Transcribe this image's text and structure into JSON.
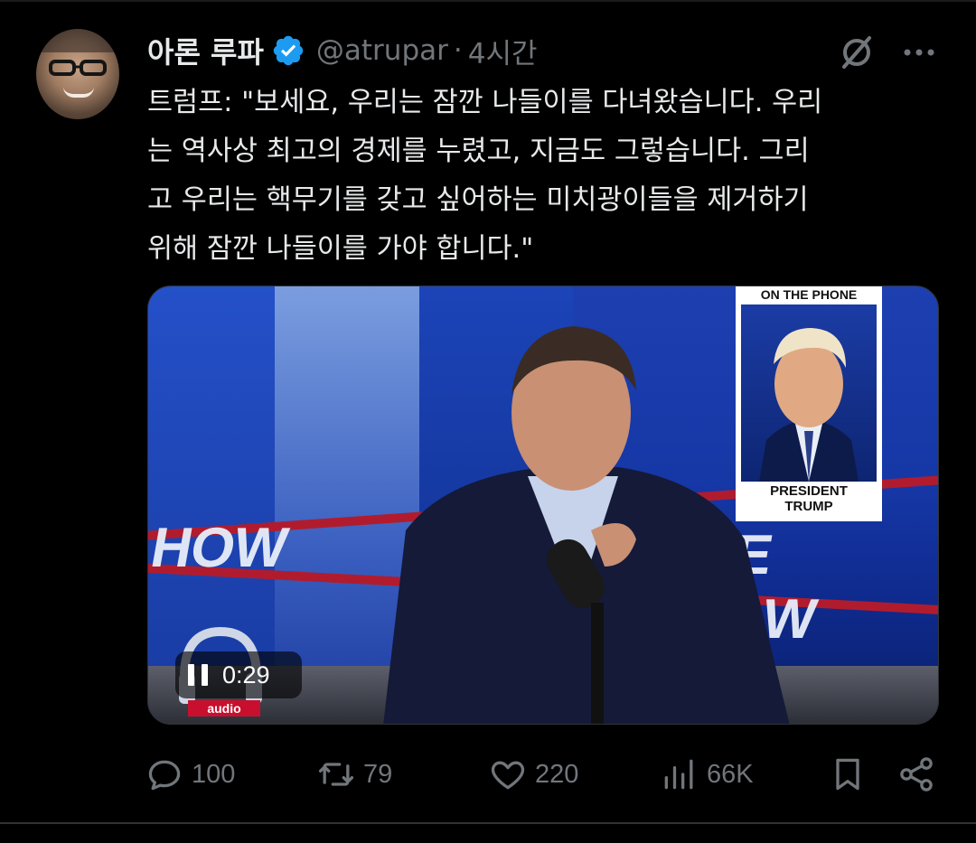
{
  "tweet": {
    "author": {
      "display_name": "아론 루파",
      "handle": "@atrupar",
      "verified": true,
      "verified_color": "#1d9bf0"
    },
    "separator": "·",
    "time": "4시간",
    "text": "트럼프: \"보세요, 우리는 잠깐 나들이를 다녀왔습니다. 우리\n는 역사상 최고의 경제를 누렸고, 지금도 그렇습니다. 그리\n고 우리는 핵무기를 갖고 싶어하는 미치광이들을 제거하기\n위해 잠깐 나들이를 가야 합니다.\"",
    "media": {
      "type": "video",
      "state": "playing",
      "timestamp": "0:29",
      "background_text_left": "HOW",
      "background_text_right": "ADE SHOW",
      "inset_header": "ON THE PHONE",
      "inset_caption_line1": "PRESIDENT",
      "inset_caption_line2": "TRUMP",
      "logo_text": "audio"
    },
    "actions": {
      "replies": "100",
      "retweets": "79",
      "likes": "220",
      "views": "66K"
    },
    "icons": {
      "grok": "grok-slash-circle-icon",
      "more": "more-horizontal-icon",
      "reply": "reply-bubble-icon",
      "retweet": "retweet-arrows-icon",
      "like": "heart-icon",
      "views": "bar-chart-icon",
      "bookmark": "bookmark-icon",
      "share": "share-icon"
    }
  }
}
